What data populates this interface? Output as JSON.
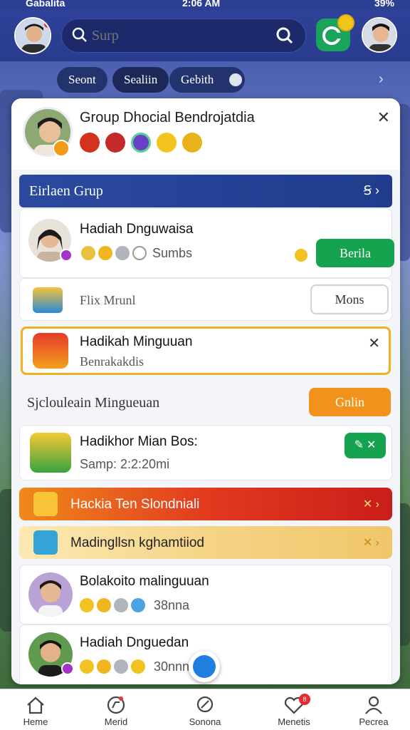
{
  "status_bar": {
    "carrier": "Gabalita",
    "time": "2:06 AM",
    "battery": "39%"
  },
  "header": {
    "search": {
      "placeholder": "Surp"
    }
  },
  "chips": [
    {
      "label": "Seont"
    },
    {
      "label": "Sealiin"
    },
    {
      "label": "Gebith"
    }
  ],
  "sheet": {
    "title": "Group Dhocial Bendrojatdia",
    "section_title": "Eirlaen Grup",
    "items": [
      {
        "title": "Hadiah Dnguwaisa",
        "sub": "Sumbs",
        "button": "Berila"
      },
      {
        "title": "Flix Mrunl",
        "button": "Mons"
      },
      {
        "title": "Hadikah Minguuan",
        "sub": "Benrakakdis"
      }
    ],
    "schedule": {
      "label": "Sjclouleain Mingueuan",
      "button": "Gnlin"
    },
    "box_card": {
      "title": "Hadikhor Mian Bos:",
      "sub": "Samp: 2:2:20mi"
    },
    "banner_red": {
      "label": "Hackia Ten Slondniali"
    },
    "banner_gold": {
      "label": "Madingllsn kghamtiiod"
    },
    "friends": [
      {
        "name": "Bolakoito malinguuan",
        "sub": "38nna"
      },
      {
        "name": "Hadiah Dnguedan",
        "sub": "30nnn"
      }
    ]
  },
  "bottom_nav": [
    {
      "label": "Heme"
    },
    {
      "label": "Merid"
    },
    {
      "label": "Sonona"
    },
    {
      "label": "Menetis",
      "badge": "8"
    },
    {
      "label": "Pecrea"
    }
  ],
  "colors": {
    "accent": "#2b4a9f",
    "green": "#16a350",
    "orange": "#f0921b",
    "gold": "#f2b120"
  }
}
